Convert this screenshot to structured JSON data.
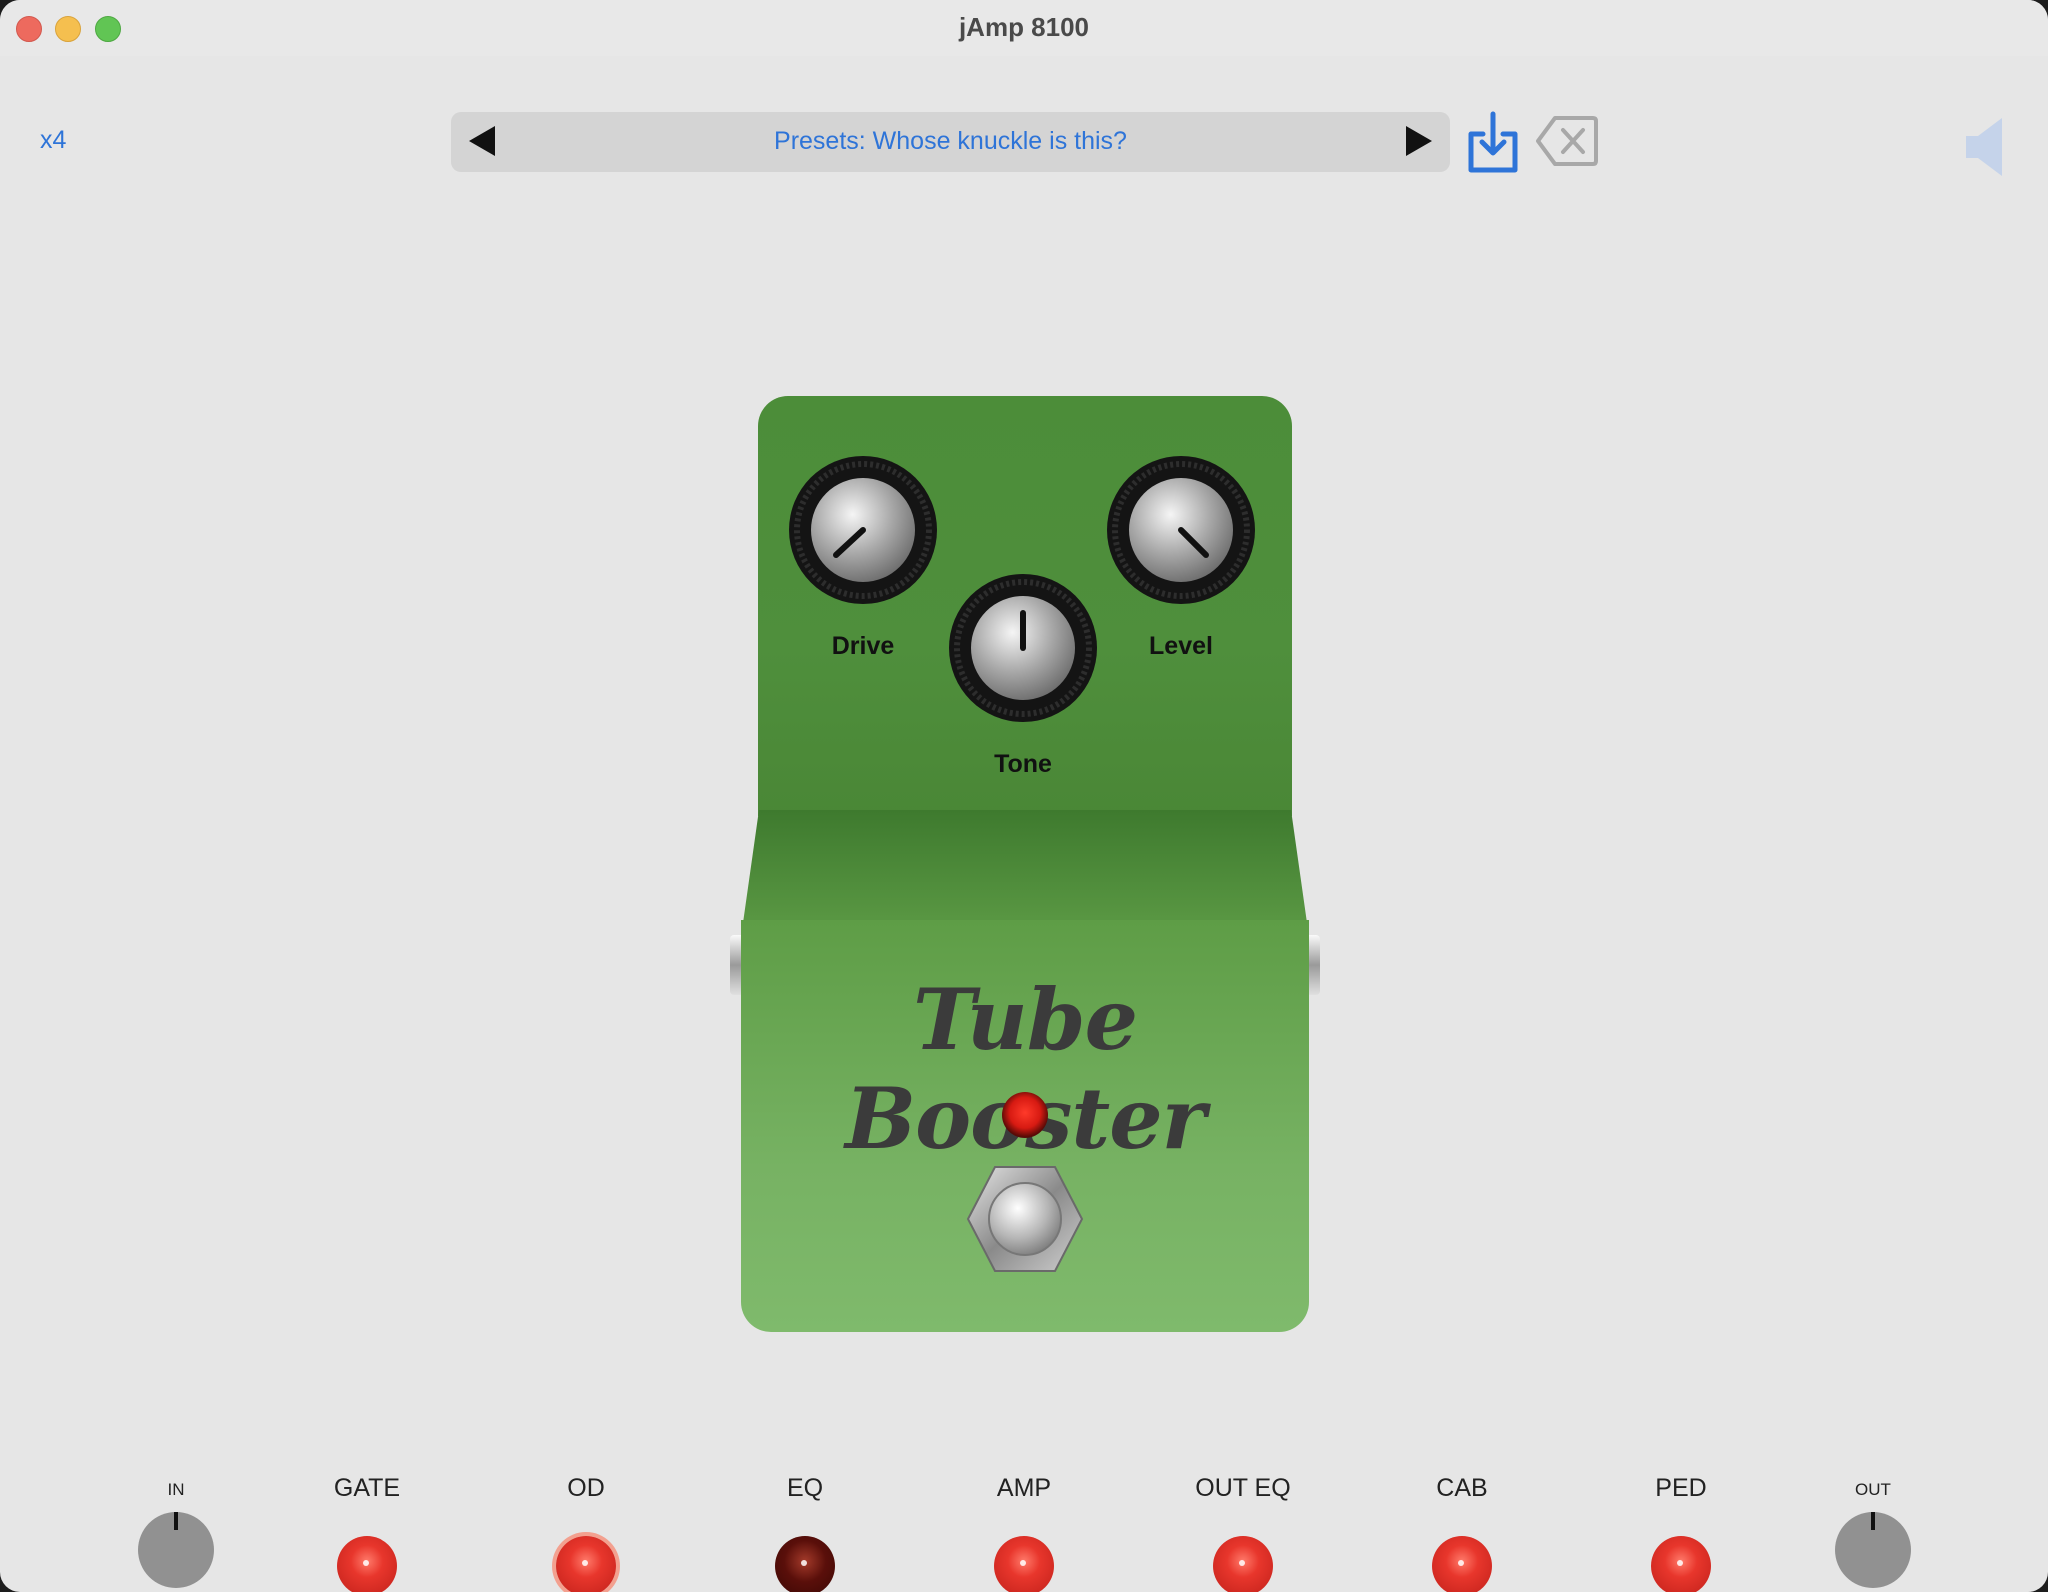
{
  "window": {
    "title": "jAmp 8100"
  },
  "toolbar": {
    "multiplier": "x4",
    "preset_label": "Presets: Whose knuckle is this?",
    "prev_icon": "triangle-left",
    "next_icon": "triangle-right",
    "save_icon": "download-tray",
    "delete_icon": "delete-backspace",
    "volume_icon": "speaker"
  },
  "pedal": {
    "name": "Tube Booster",
    "color": "#5a9a45",
    "led_state": "on",
    "knobs": [
      {
        "label": "Drive"
      },
      {
        "label": "Tone"
      },
      {
        "label": "Level"
      }
    ]
  },
  "chain": {
    "input_label": "IN",
    "output_label": "OUT",
    "stages": [
      {
        "label": "GATE",
        "state": "on"
      },
      {
        "label": "OD",
        "state": "on-selected"
      },
      {
        "label": "EQ",
        "state": "off"
      },
      {
        "label": "AMP",
        "state": "on"
      },
      {
        "label": "OUT EQ",
        "state": "on"
      },
      {
        "label": "CAB",
        "state": "on"
      },
      {
        "label": "PED",
        "state": "on"
      }
    ]
  },
  "colors": {
    "accent": "#2e74d8",
    "led_on": "#e8362c",
    "led_off": "#5a0f0a"
  }
}
